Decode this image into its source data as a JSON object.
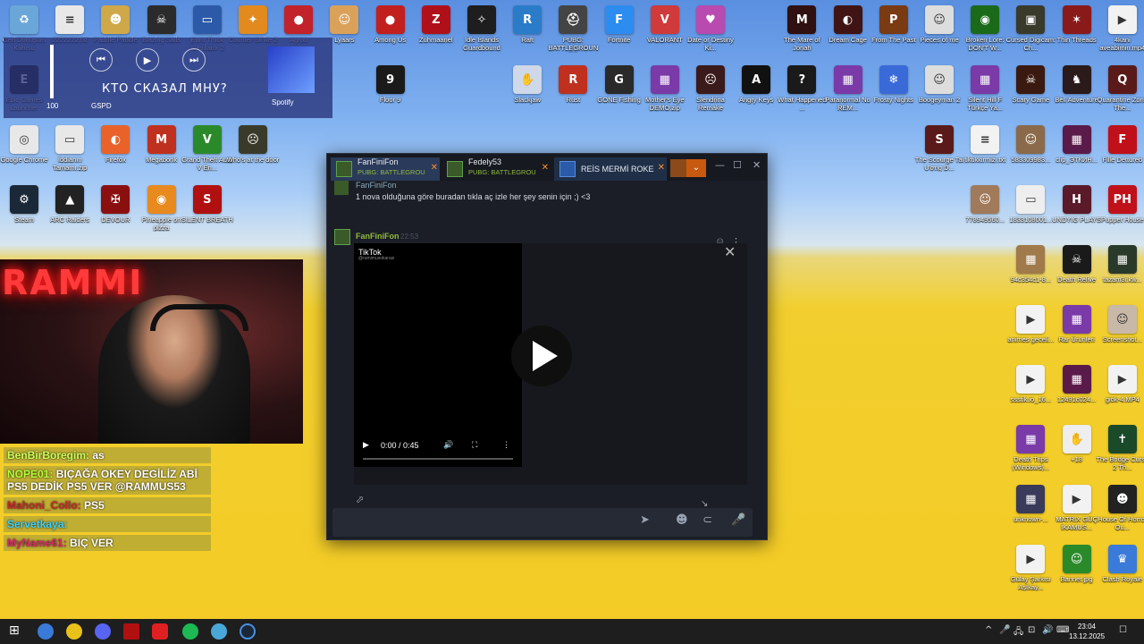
{
  "desktop_icons": [
    {
      "label": "Geri Dönüşüm Kutusu",
      "color": "#6aa6d8",
      "glyph": "♻",
      "col": 0,
      "row": 0
    },
    {
      "label": "2222222.txt",
      "color": "#e8e8e8",
      "glyph": "≡",
      "col": 1,
      "row": 0
    },
    {
      "label": "Paddle Paddle",
      "color": "#cfa84a",
      "glyph": "☻",
      "col": 2,
      "row": 0
    },
    {
      "label": "Blazing Sails",
      "color": "#2b2b2b",
      "glyph": "☠",
      "col": 3,
      "row": 0
    },
    {
      "label": "Euro Truck Simulator 2",
      "color": "#2d5aa8",
      "glyph": "▭",
      "col": 4,
      "row": 0
    },
    {
      "label": "Counter-Strike 2",
      "color": "#e28a1e",
      "glyph": "✦",
      "col": 5,
      "row": 0
    },
    {
      "label": "Agrou",
      "color": "#c2222a",
      "glyph": "●",
      "col": 6,
      "row": 0
    },
    {
      "label": "Lyaars",
      "color": "#d9a15a",
      "glyph": "☺",
      "col": 7,
      "row": 0
    },
    {
      "label": "Among Us",
      "color": "#c21f1f",
      "glyph": "●",
      "col": 8,
      "row": 0
    },
    {
      "label": "Zuhmaanel",
      "color": "#b0101a",
      "glyph": "Z",
      "col": 9,
      "row": 0
    },
    {
      "label": "Idle Islands Guardbound",
      "color": "#1e1e1e",
      "glyph": "✧",
      "col": 10,
      "row": 0
    },
    {
      "label": "Raft",
      "color": "#2a7cc8",
      "glyph": "R",
      "col": 11,
      "row": 0
    },
    {
      "label": "PUBG: BATTLEGROUNDS",
      "color": "#444",
      "glyph": "⛑",
      "col": 12,
      "row": 0
    },
    {
      "label": "Fortnite",
      "color": "#2d8cf0",
      "glyph": "F",
      "col": 13,
      "row": 0
    },
    {
      "label": "VALORANT",
      "color": "#d03a3a",
      "glyph": "V",
      "col": 14,
      "row": 0
    },
    {
      "label": "Date or Destiny Ki...",
      "color": "#b84ab0",
      "glyph": "♥",
      "col": 15,
      "row": 0
    },
    {
      "label": "The Mare of Jonah",
      "color": "#301010",
      "glyph": "M",
      "col": 17,
      "row": 0
    },
    {
      "label": "Dream Cage",
      "color": "#401414",
      "glyph": "◐",
      "col": 18,
      "row": 0
    },
    {
      "label": "From The Past",
      "color": "#7a3a12",
      "glyph": "P",
      "col": 19,
      "row": 0
    },
    {
      "label": "Pieces of me",
      "color": "#ddd",
      "glyph": "☺",
      "col": 20,
      "row": 0
    },
    {
      "label": "Broken Lore: DON'T W...",
      "color": "#1a6a1a",
      "glyph": "◉",
      "col": 21,
      "row": 0
    },
    {
      "label": "Cursed Digicam: Ch...",
      "color": "#3a3a2a",
      "glyph": "▣",
      "col": 22,
      "row": 0
    },
    {
      "label": "Thin Threads",
      "color": "#8a1a1a",
      "glyph": "✶",
      "col": 23,
      "row": 0
    },
    {
      "label": "4kani aveabimin.mp4",
      "color": "#f2f2f2",
      "glyph": "▶",
      "col": 24,
      "row": 0
    },
    {
      "label": "Epic Games Launcher",
      "color": "#222",
      "glyph": "E",
      "col": 0,
      "row": 1
    },
    {
      "label": "Floor 9",
      "color": "#1a1a1a",
      "glyph": "9",
      "col": 8,
      "row": 1
    },
    {
      "label": "Slackjaw",
      "color": "#cfd8e8",
      "glyph": "✋",
      "col": 11,
      "row": 1
    },
    {
      "label": "Rust",
      "color": "#c0301e",
      "glyph": "R",
      "col": 12,
      "row": 1
    },
    {
      "label": "GONE Fishing",
      "color": "#2a2a2a",
      "glyph": "G",
      "col": 13,
      "row": 1
    },
    {
      "label": "Mother's Eye DEMO.zip",
      "color": "#7a3aa8",
      "glyph": "▦",
      "col": 14,
      "row": 1
    },
    {
      "label": "Slendrina Remake",
      "color": "#3a1a1a",
      "glyph": "☹",
      "col": 15,
      "row": 1
    },
    {
      "label": "Angry Keys",
      "color": "#111",
      "glyph": "A",
      "col": 16,
      "row": 1
    },
    {
      "label": "What Happened ...",
      "color": "#1a1a1a",
      "glyph": "?",
      "col": 17,
      "row": 1
    },
    {
      "label": "Paranormal No REM...",
      "color": "#7a3aa8",
      "glyph": "▦",
      "col": 18,
      "row": 1
    },
    {
      "label": "Frosty Nights",
      "color": "#3a6ad8",
      "glyph": "❄",
      "col": 19,
      "row": 1
    },
    {
      "label": "Boogeyman 2",
      "color": "#ddd",
      "glyph": "☺",
      "col": 20,
      "row": 1
    },
    {
      "label": "Silent Hill F Türkçe Ya...",
      "color": "#7a3aa8",
      "glyph": "▦",
      "col": 21,
      "row": 1
    },
    {
      "label": "Scary Game",
      "color": "#3a1a10",
      "glyph": "☠",
      "col": 22,
      "row": 1
    },
    {
      "label": "Bell Adventure",
      "color": "#2a1a1a",
      "glyph": "♞",
      "col": 23,
      "row": 1
    },
    {
      "label": "Quarantine Zone The...",
      "color": "#5a1a1a",
      "glyph": "Q",
      "col": 24,
      "row": 1
    },
    {
      "label": "Google Chrome",
      "color": "#e8e8e8",
      "glyph": "◎",
      "col": 0,
      "row": 2
    },
    {
      "label": "İddianın Tamamı.zip",
      "color": "#e8e8e8",
      "glyph": "▭",
      "col": 1,
      "row": 2
    },
    {
      "label": "Firefox",
      "color": "#e8622a",
      "glyph": "◐",
      "col": 2,
      "row": 2
    },
    {
      "label": "Megabonk",
      "color": "#c0301e",
      "glyph": "M",
      "col": 3,
      "row": 2
    },
    {
      "label": "Grand Theft Auto V En...",
      "color": "#2a8a2a",
      "glyph": "V",
      "col": 4,
      "row": 2
    },
    {
      "label": "Who's at the door",
      "color": "#3a3a2a",
      "glyph": "☹",
      "col": 5,
      "row": 2
    },
    {
      "label": "The Scourge Tai Ương D...",
      "color": "#5a1a1a",
      "glyph": "S",
      "col": 20,
      "row": 2
    },
    {
      "label": "tiktikkirmizi.txt",
      "color": "#f2f2f2",
      "glyph": "≡",
      "col": 21,
      "row": 2
    },
    {
      "label": "583309983...",
      "color": "#8a6a4a",
      "glyph": "☺",
      "col": 22,
      "row": 2
    },
    {
      "label": "clip_ЭТКИН...",
      "color": "#5a1a4a",
      "glyph": "▦",
      "col": 23,
      "row": 2
    },
    {
      "label": "Fille Dettured",
      "color": "#c0101a",
      "glyph": "F",
      "col": 24,
      "row": 2
    },
    {
      "label": "Steam",
      "color": "#1b2838",
      "glyph": "⚙",
      "col": 0,
      "row": 3
    },
    {
      "label": "ARC Raiders",
      "color": "#222",
      "glyph": "▲",
      "col": 1,
      "row": 3
    },
    {
      "label": "DEVOUR",
      "color": "#8a1010",
      "glyph": "✠",
      "col": 2,
      "row": 3
    },
    {
      "label": "Pineapple on pizza",
      "color": "#e88a1e",
      "glyph": "◉",
      "col": 3,
      "row": 3
    },
    {
      "label": "SILENT BREATH",
      "color": "#b01010",
      "glyph": "S",
      "col": 4,
      "row": 3
    },
    {
      "label": "778949560...",
      "color": "#a07a5a",
      "glyph": "☺",
      "col": 21,
      "row": 3
    },
    {
      "label": "1833108001...",
      "color": "#eee",
      "glyph": "▭",
      "col": 22,
      "row": 3
    },
    {
      "label": "UNDYIG PLAYS",
      "color": "#5a1a2a",
      "glyph": "H",
      "col": 23,
      "row": 3
    },
    {
      "label": "Puppet House",
      "color": "#c0101a",
      "glyph": "PH",
      "col": 24,
      "row": 3
    },
    {
      "label": "94c354c1-8...",
      "color": "#a07a4a",
      "glyph": "▦",
      "col": 22,
      "row": 4
    },
    {
      "label": "Death Relive",
      "color": "#1a1a1a",
      "glyph": "☠",
      "col": 23,
      "row": 4
    },
    {
      "label": "tazam3i.kw...",
      "color": "#2a3a2a",
      "glyph": "▦",
      "col": 24,
      "row": 4
    },
    {
      "label": "animes geceli...",
      "color": "#f2f2f2",
      "glyph": "▶",
      "col": 22,
      "row": 5
    },
    {
      "label": "Rar Ürünleri",
      "color": "#7a3aa8",
      "glyph": "▦",
      "col": 23,
      "row": 5
    },
    {
      "label": "Screenshot...",
      "color": "#c8b8a8",
      "glyph": "☺",
      "col": 24,
      "row": 5
    },
    {
      "label": "ssstik.io_16...",
      "color": "#f2f2f2",
      "glyph": "▶",
      "col": 22,
      "row": 6
    },
    {
      "label": "12491c024...",
      "color": "#5a1a4a",
      "glyph": "▦",
      "col": 23,
      "row": 6
    },
    {
      "label": "giok-4.MP4",
      "color": "#f2f2f2",
      "glyph": "▶",
      "col": 24,
      "row": 6
    },
    {
      "label": "Death Trips (Windows)...",
      "color": "#7a3aa8",
      "glyph": "▦",
      "col": 22,
      "row": 7
    },
    {
      "label": "+18",
      "color": "#eee",
      "glyph": "✋",
      "col": 23,
      "row": 7
    },
    {
      "label": "The Bridge Curse 2 Th...",
      "color": "#1a4a2a",
      "glyph": "✝",
      "col": 24,
      "row": 7
    },
    {
      "label": "unknown-...",
      "color": "#3a3a5a",
      "glyph": "▦",
      "col": 22,
      "row": 8
    },
    {
      "label": "MATRIX GÜÇ İKAMUS...",
      "color": "#f2f2f2",
      "glyph": "▶",
      "col": 23,
      "row": 8
    },
    {
      "label": "House Of Horror Ou...",
      "color": "#222",
      "glyph": "☻",
      "col": 24,
      "row": 8
    },
    {
      "label": "Gülay Şarkısı Aşİkay...",
      "color": "#f2f2f2",
      "glyph": "▶",
      "col": 22,
      "row": 9
    },
    {
      "label": "Banner.jpg",
      "color": "#2a8a2a",
      "glyph": "☺",
      "col": 23,
      "row": 9
    },
    {
      "label": "Clash Royale",
      "color": "#3a7ad8",
      "glyph": "♛",
      "col": 24,
      "row": 9
    }
  ],
  "media_overlay": {
    "prev_label": "⏮",
    "play_label": "▶",
    "next_label": "⏭",
    "song_title": "КТО СКАЗАЛ МНУ?",
    "volume": "100",
    "volume_level": 1.0,
    "gspd": "GSPD",
    "source": "Spotify"
  },
  "webcam": {
    "neon_text": "RAMMI"
  },
  "stream_chat": [
    {
      "user": "BenBirBoregim:",
      "text": "as",
      "cls": "u1"
    },
    {
      "user": "NOPE01:",
      "text": "BIÇAĞA OKEY DEGİLİZ ABİ PS5 DEDİK PS5 VER @RAMMUS53",
      "cls": "u2"
    },
    {
      "user": "Mahoni_Collo:",
      "text": "PS5",
      "cls": "u3"
    },
    {
      "user": "Servetkaya:",
      "text": "",
      "cls": "u4"
    },
    {
      "user": "MyName61:",
      "text": "BIÇ VER",
      "cls": "u5"
    }
  ],
  "steam_chat": {
    "tabs": [
      {
        "name": "FanFiniFon",
        "game": "PUBG: BATTLEGROU"
      },
      {
        "name": "Fedely53",
        "game": "PUBG: BATTLEGROU"
      },
      {
        "name": "REİS MERMİ ROKE",
        "game": ""
      }
    ],
    "close_tab_label": "✕",
    "dropdown_label": "⌄",
    "window_controls": {
      "minimize": "—",
      "maximize": "☐",
      "close": "✕"
    },
    "previous_sender": "FanFiniFon",
    "previous_message": "1 nova olduğuna göre buradan tıkla aç izle her şey senin için ;) <3",
    "message_sender": "FanFiniFon",
    "message_time": "22:53",
    "embed": {
      "provider": "TikTok",
      "provider_sub": "@ramimusokarasi",
      "time": "0:00 / 0:45",
      "play_label": "▶",
      "volume_label": "🔊",
      "fullscreen_label": "⛶",
      "more_label": "⋮",
      "close_label": "✕",
      "expand_label": "⬀",
      "resize_label": "↘"
    },
    "reaction_label": "☺",
    "more_actions_label": "⋮",
    "composer": {
      "placeholder": "",
      "send_label": "➤",
      "emoji_label": "☻",
      "attach_label": "⊂",
      "voice_label": "🎤"
    }
  },
  "taskbar": {
    "start_label": "⊞",
    "time": "23:04",
    "date": "13.12.2025",
    "tray_labels": [
      "^",
      "🎤",
      "🖧",
      "⊡",
      "🔊",
      "⌨"
    ],
    "notification_label": "☐"
  }
}
